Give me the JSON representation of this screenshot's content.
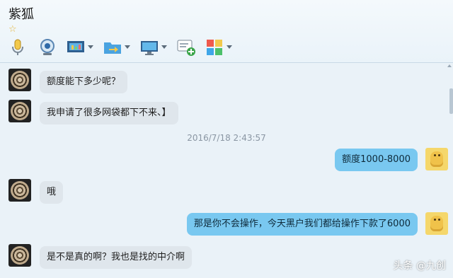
{
  "window": {
    "title": "紫狐",
    "star": "☆"
  },
  "toolbar": {
    "items": [
      {
        "name": "voice-call",
        "icon": "microphone-icon",
        "has_menu": false
      },
      {
        "name": "video-call",
        "icon": "webcam-icon",
        "has_menu": false
      },
      {
        "name": "screen-share",
        "icon": "presentation-icon",
        "has_menu": true
      },
      {
        "name": "file-transfer",
        "icon": "folder-arrow-icon",
        "has_menu": true
      },
      {
        "name": "remote-desktop",
        "icon": "monitor-icon",
        "has_menu": true
      },
      {
        "name": "add-chat",
        "icon": "chat-plus-icon",
        "has_menu": false
      },
      {
        "name": "apps",
        "icon": "apps-grid-icon",
        "has_menu": true
      }
    ]
  },
  "chat": {
    "timestamp": "2016/7/18 2:43:57",
    "messages": [
      {
        "side": "left",
        "text": "额度能下多少呢？"
      },
      {
        "side": "left",
        "text": "我申请了很多网袋都下不来、】"
      },
      {
        "side": "right",
        "text": "额度1000-8000"
      },
      {
        "side": "left",
        "text": "哦"
      },
      {
        "side": "right",
        "text": "那是你不会操作，今天黑户我们都给操作下款了6000"
      },
      {
        "side": "left",
        "text": "是不是真的啊？我也是找的中介啊"
      }
    ]
  },
  "watermark": "头条 @九创",
  "colors": {
    "left_bubble": "#dfe6ec",
    "right_bubble": "#79c8f0",
    "background": "#eaf2f8"
  }
}
